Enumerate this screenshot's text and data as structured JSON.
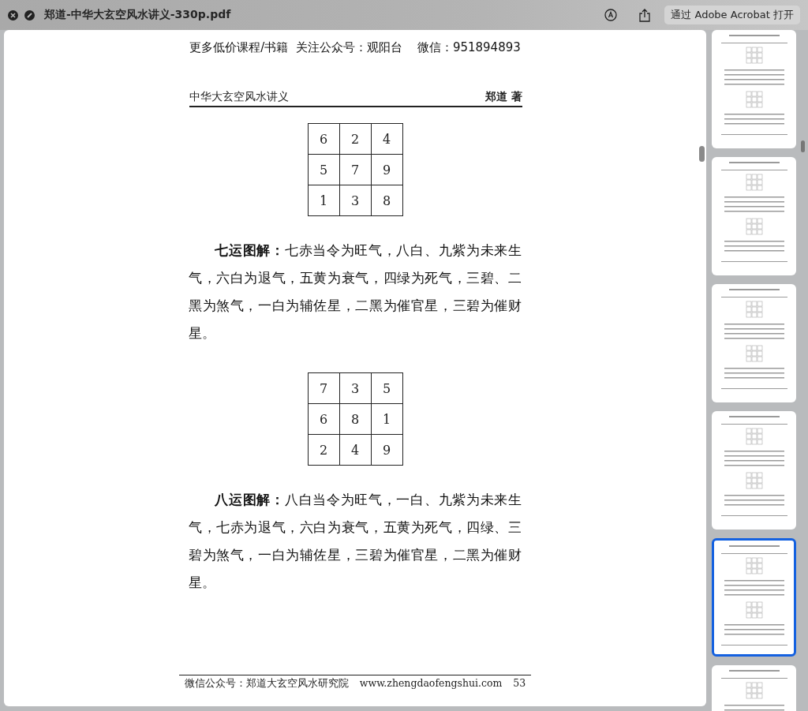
{
  "window": {
    "title": "郑道-中华大玄空风水讲义-330p.pdf",
    "open_button": "通过 Adobe Acrobat 打开"
  },
  "page": {
    "banner": "更多低价课程/书籍  关注公众号：观阳台    微信：951894893",
    "header": {
      "book_title": "中华大玄空风水讲义",
      "author": "郑道 著"
    },
    "blocks": [
      {
        "kind": "grid",
        "rows": [
          [
            "6",
            "2",
            "4"
          ],
          [
            "5",
            "7",
            "9"
          ],
          [
            "1",
            "3",
            "8"
          ]
        ]
      },
      {
        "kind": "paragraph",
        "text": "**七运图解：**七赤当令为旺气，八白、九紫为未来生气，六白为退气，五黄为衰气，四绿为死气，三碧、二黑为煞气，一白为辅佐星，二黑为催官星，三碧为催财星。"
      },
      {
        "kind": "grid",
        "rows": [
          [
            "7",
            "3",
            "5"
          ],
          [
            "6",
            "8",
            "1"
          ],
          [
            "2",
            "4",
            "9"
          ]
        ]
      },
      {
        "kind": "paragraph",
        "text": "**八运图解：**八白当令为旺气，一白、九紫为未来生气，七赤为退气，六白为衰气，五黄为死气，四绿、三碧为煞气，一白为辅佐星，三碧为催官星，二黑为催财星。"
      }
    ],
    "footer": {
      "account": "微信公众号：郑道大玄空风水研究院",
      "website": "www.zhengdaofengshui.com",
      "page_number": "53"
    }
  },
  "thumbnails": [
    {
      "selected": false
    },
    {
      "selected": false
    },
    {
      "selected": false
    },
    {
      "selected": false
    },
    {
      "selected": true
    },
    {
      "selected": false
    }
  ]
}
